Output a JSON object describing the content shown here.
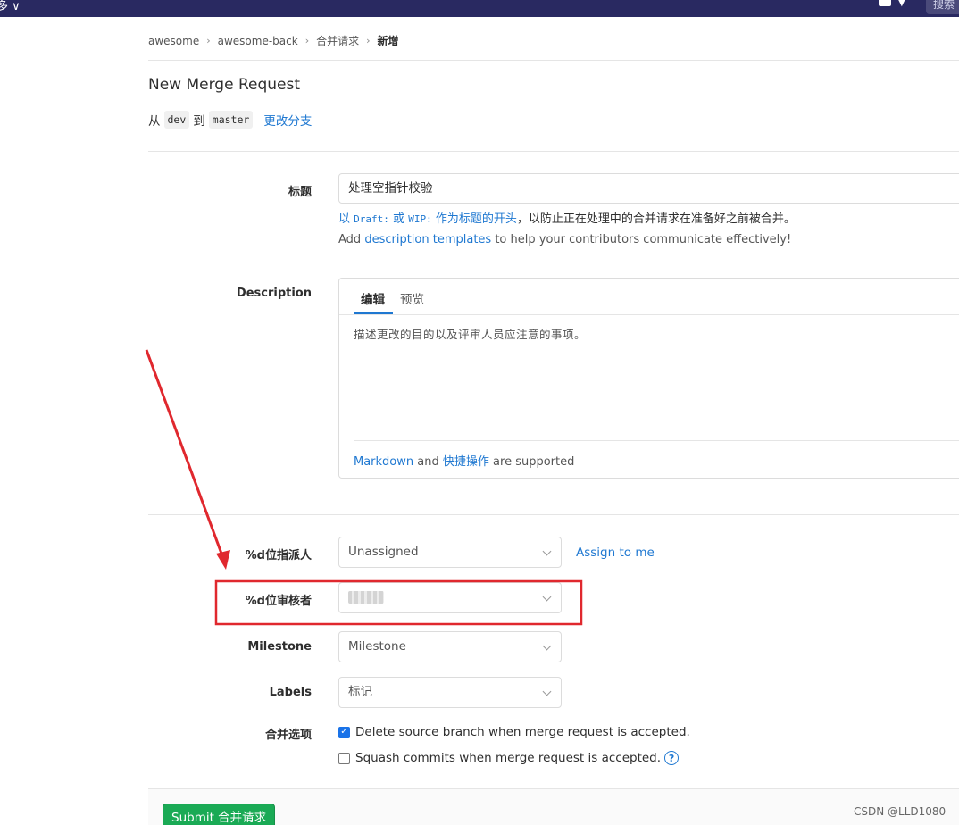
{
  "topbar": {
    "left_fragment": "多 ∨",
    "search_placeholder": "搜索"
  },
  "breadcrumb": [
    {
      "label": "awesome"
    },
    {
      "label": "awesome-back"
    },
    {
      "label": "合并请求"
    },
    {
      "label": "新增"
    }
  ],
  "page": {
    "title": "New Merge Request",
    "from_word": "从",
    "source_branch": "dev",
    "to_word": "到",
    "target_branch": "master",
    "change_branches": "更改分支"
  },
  "form": {
    "title_label": "标题",
    "title_value": "处理空指针校验",
    "hint_prefix": "以",
    "hint_draft": "Draft:",
    "hint_or": "或",
    "hint_wip": "WIP:",
    "hint_blue": "作为标题的开头",
    "hint_rest": "，以防止正在处理中的合并请求在准备好之前被合并。",
    "templates_add": "Add",
    "templates_link": "description templates",
    "templates_rest": "to help your contributors communicate effectively!",
    "description_label": "Description",
    "tab_edit": "编辑",
    "tab_preview": "预览",
    "description_placeholder": "描述更改的目的以及评审人员应注意的事项。",
    "md_link": "Markdown",
    "md_and": "and",
    "quick_link": "快捷操作",
    "supported": "are supported",
    "assignee_label": "%d位指派人",
    "assignee_value": "Unassigned",
    "assign_to_me": "Assign to me",
    "reviewer_label": "%d位审核者",
    "milestone_label": "Milestone",
    "milestone_value": "Milestone",
    "labels_label": "Labels",
    "labels_value": "标记",
    "merge_options_label": "合并选项",
    "delete_branch": "Delete source branch when merge request is accepted.",
    "squash": "Squash commits when merge request is accepted.",
    "submit": "Submit 合并请求"
  },
  "watermark": "CSDN @LLD1080",
  "annotation_color": "#e0282e"
}
